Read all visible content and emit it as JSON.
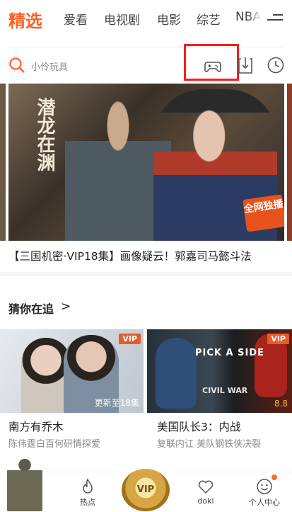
{
  "top_nav": {
    "tabs": [
      "精选",
      "爱看",
      "电视剧",
      "电影",
      "综艺",
      "NBA"
    ],
    "active_index": 0
  },
  "search": {
    "placeholder": "小伶玩具"
  },
  "banner": {
    "caption": "【三国机密·VIP18集】画像疑云！郭嘉司马懿斗法",
    "title_art": "潜龙在渊",
    "badge": "全网独播"
  },
  "section": {
    "title": "猜你在追",
    "arrow": ">"
  },
  "cards": [
    {
      "title": "南方有乔木",
      "subtitle": "陈伟霆白百何研情探爱",
      "tag": "VIP",
      "overlay": "更新至18集"
    },
    {
      "title": "美国队长3：内战",
      "subtitle": "复联内讧 美队钢铁侠决裂",
      "tag": "VIP",
      "overlay": "8.8",
      "poster_text_1": "PICK A SIDE",
      "poster_text_2": "CIVIL WAR"
    }
  ],
  "tabbar": {
    "items": [
      "热点",
      "VIP",
      "doki",
      "个人中心"
    ]
  },
  "colors": {
    "brand": "#ff6022",
    "vip_tag": "#e95a2a",
    "highlight_box": "#ff1a1a"
  },
  "icons": [
    "search-icon",
    "gamepad-icon",
    "download-icon",
    "history-icon",
    "menu-icon",
    "flame-icon",
    "doki-icon",
    "smiley-icon"
  ]
}
